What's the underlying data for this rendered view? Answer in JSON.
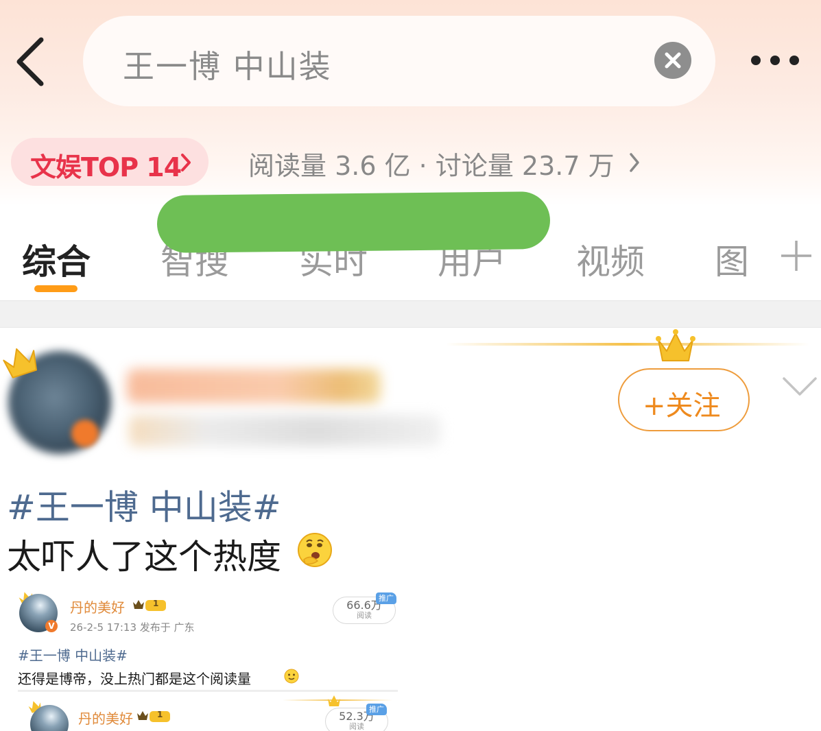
{
  "search": {
    "query": "王一博 中山装"
  },
  "topic": {
    "rank_label": "文娱TOP 14",
    "stats": "阅读量 3.6 亿 · 讨论量 23.7 万"
  },
  "tabs": [
    {
      "label": "综合",
      "active": true
    },
    {
      "label": "智搜"
    },
    {
      "label": "实时"
    },
    {
      "label": "用户"
    },
    {
      "label": "视频"
    },
    {
      "label": "图"
    }
  ],
  "post": {
    "follow_label": "+关注",
    "hashtag": "#王一博 中山装#",
    "text": "太吓人了这个热度"
  },
  "embedded": [
    {
      "name": "丹的美好",
      "level": "1",
      "verified_badge": "V",
      "meta": "26-2-5 17:13  发布于 广东",
      "reads": "66.6万",
      "reads_label": "阅读",
      "ad_label": "推广",
      "hashtag": "#王一博 中山装#",
      "text": "还得是博帝，没上热门都是这个阅读量"
    },
    {
      "name": "丹的美好",
      "level": "1",
      "reads": "52.3万",
      "reads_label": "阅读",
      "ad_label": "推广"
    }
  ],
  "colors": {
    "accent_orange": "#ff9c17",
    "rank_red": "#e8334a",
    "hashtag_blue": "#4e6a8f",
    "redaction_green": "#6ebf55"
  },
  "icons": [
    "back-arrow-icon",
    "clear-icon",
    "more-icon",
    "chevron-right-icon",
    "plus-icon",
    "crown-icon",
    "chevron-down-icon",
    "emoji-icon"
  ]
}
